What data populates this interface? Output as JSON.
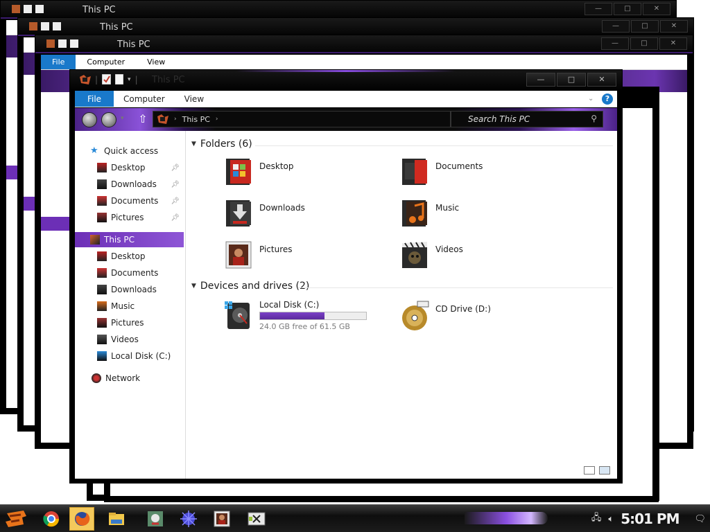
{
  "window": {
    "title": "This PC",
    "ribbon": {
      "file": "File",
      "tabs": [
        "Computer",
        "View"
      ],
      "help": "?"
    },
    "address": {
      "crumb": "This PC"
    },
    "search": {
      "placeholder": "Search This PC"
    },
    "controls": {
      "minimize": "—",
      "maximize": "□",
      "close": "✕"
    }
  },
  "background_windows": {
    "title": "This PC",
    "ribbon_tabs": [
      "File",
      "Computer",
      "View"
    ]
  },
  "nav": {
    "quick_access": "Quick access",
    "quick_items": [
      "Desktop",
      "Downloads",
      "Documents",
      "Pictures"
    ],
    "this_pc": "This PC",
    "pc_items": [
      "Desktop",
      "Documents",
      "Downloads",
      "Music",
      "Pictures",
      "Videos",
      "Local Disk (C:)"
    ],
    "network": "Network"
  },
  "content": {
    "folders_header": "Folders (6)",
    "folders": [
      {
        "label": "Desktop",
        "icon": "desktop-folder-icon"
      },
      {
        "label": "Documents",
        "icon": "documents-folder-icon"
      },
      {
        "label": "Downloads",
        "icon": "downloads-folder-icon"
      },
      {
        "label": "Music",
        "icon": "music-folder-icon"
      },
      {
        "label": "Pictures",
        "icon": "pictures-folder-icon"
      },
      {
        "label": "Videos",
        "icon": "videos-folder-icon"
      }
    ],
    "devices_header": "Devices and drives (2)",
    "drives": [
      {
        "label": "Local Disk (C:)",
        "free_text": "24.0 GB free of 61.5 GB",
        "used_fraction": 0.61,
        "icon": "hard-disk-icon"
      },
      {
        "label": "CD Drive (D:)",
        "icon": "cd-drive-icon"
      }
    ]
  },
  "taskbar": {
    "apps": [
      "chrome-icon",
      "firefox-icon",
      "file-explorer-icon",
      "paint-icon",
      "network-orb-icon",
      "photo-icon",
      "media-icon"
    ],
    "clock": "5:01 PM"
  },
  "colors": {
    "accent_purple": "#6c2fb6",
    "file_tab_blue": "#1979ca",
    "titlebar_black": "#050505"
  }
}
